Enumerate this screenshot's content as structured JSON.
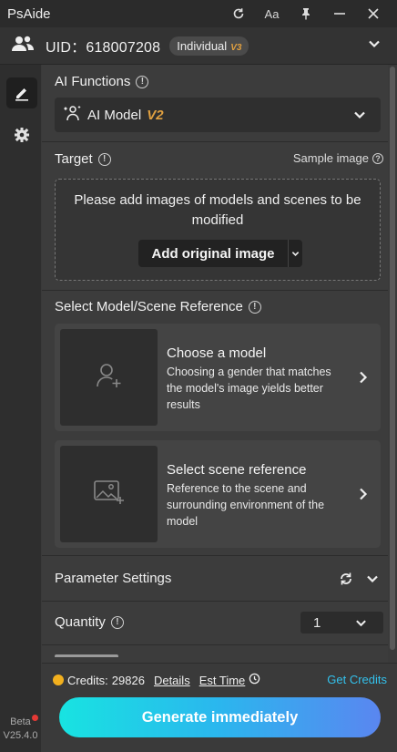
{
  "app": {
    "title": "PsAide"
  },
  "titlebar": {
    "icons": [
      "refresh-icon",
      "font-size-icon",
      "pin-icon",
      "minimize-icon",
      "close-icon"
    ],
    "font_label": "Aa"
  },
  "user": {
    "uid_text": "UID：618007208",
    "plan": "Individual",
    "plan_version": "V3"
  },
  "sidebar": {
    "items": [
      "edit-icon",
      "settings-icon"
    ],
    "beta_label": "Beta",
    "version": "V25.4.0"
  },
  "ai_functions": {
    "label": "AI Functions",
    "selected": "AI Model",
    "selected_version": "V2"
  },
  "target": {
    "label": "Target",
    "sample_link": "Sample image",
    "dropzone_text": "Please add images of models and scenes to be modified",
    "add_button": "Add original image"
  },
  "reference": {
    "label": "Select Model/Scene Reference",
    "cards": [
      {
        "title": "Choose a model",
        "description": "Choosing a gender that matches the model's image yields better results"
      },
      {
        "title": "Select scene reference",
        "description": "Reference to the scene and surrounding environment of the model"
      }
    ]
  },
  "parameters": {
    "label": "Parameter Settings"
  },
  "quantity": {
    "label": "Quantity",
    "value": "1"
  },
  "footer": {
    "credits_label": "Credits:",
    "credits_value": "29826",
    "details_link": "Details",
    "est_time_link": "Est Time",
    "get_credits": "Get Credits",
    "generate_button": "Generate immediately"
  },
  "colors": {
    "accent_gradient_start": "#18e3e1",
    "accent_gradient_end": "#5a86f0",
    "link": "#33c1ec",
    "version_badge": "#e0a040"
  }
}
